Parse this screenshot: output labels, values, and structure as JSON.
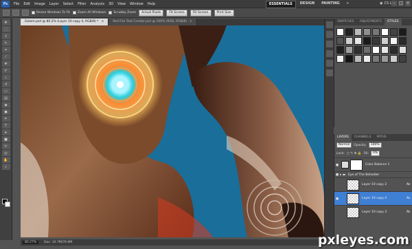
{
  "app": {
    "logo": "Ps",
    "menu": [
      "File",
      "Edit",
      "Image",
      "Layer",
      "Select",
      "Filter",
      "Analysis",
      "3D",
      "View",
      "Window",
      "Help"
    ],
    "workspaces": [
      "ESSENTIALS",
      "DESIGN",
      "PAINTING"
    ],
    "workspace_more": "»",
    "cs_live": "CS Live",
    "window_controls": [
      "–",
      "□",
      "×"
    ]
  },
  "options": {
    "resize_windows": "Resize Windows To Fit",
    "zoom_all": "Zoom All Windows",
    "scrubby_zoom": "Scrubby Zoom",
    "actual_pixels": "Actual Pixels",
    "fit_screen": "Fit Screen",
    "fill_screen": "Fill Screen",
    "print_size": "Print Size"
  },
  "documents": [
    {
      "title": "Golem.psd @ 80.2% (Layer 10 copy 4, RGB/8) *",
      "active": true
    },
    {
      "title": "Red Fire Text Creator.psd @ 100% (RGB, RGB/8)",
      "active": false
    }
  ],
  "status": {
    "zoom": "80.27%",
    "doc": "Doc: 10.7M/76.9M"
  },
  "styles_panel": {
    "tabs": [
      "SWATCHES",
      "ADJUSTMENTS",
      "STYLES"
    ],
    "swatch_colors": [
      "#ffffff",
      "#222222",
      "#bdbdbd",
      "#8f8f8f",
      "#777777",
      "#ffffff",
      "#444444",
      "#1c1c1c",
      "#555555",
      "#cfcfcf",
      "#e6e6e6",
      "#1a1a1a",
      "#3a3a3a",
      "#cfcfcf",
      "#f4f4f4",
      "#2a2a2a",
      "#202020",
      "#a0a0a0",
      "#303030",
      "#6d6d6d",
      "#ffffff",
      "#e6e6e6",
      "#2c2c2c",
      "#e0e0e0",
      "#f0f0f0",
      "#151515",
      "#bcbcbc",
      "#ececec",
      "#7a7a7a",
      "#999999",
      "#cfcfcf",
      "#404040"
    ]
  },
  "layers_panel": {
    "tabs": [
      "LAYERS",
      "CHANNELS",
      "PATHS"
    ],
    "blend_mode": "Normal",
    "opacity_label": "Opacity:",
    "opacity_value": "100%",
    "lock_label": "Lock:",
    "fill_label": "Fill:",
    "fill_value": "0%",
    "layers": [
      {
        "name": "Color Balance 1",
        "type": "adjustment",
        "selected": false
      },
      {
        "name": "Eye of The Beholder",
        "type": "group",
        "selected": false
      },
      {
        "name": "Layer 10 copy 2",
        "type": "pixel",
        "selected": false,
        "fx": "fx"
      },
      {
        "name": "Layer 10 copy 4",
        "type": "pixel",
        "selected": true,
        "fx": "fx"
      },
      {
        "name": "Layer 10 copy 3",
        "type": "pixel",
        "selected": false,
        "fx": "fx"
      }
    ]
  },
  "watermark": "pxleyes.com",
  "colors": {
    "canvas_sky": "#1a6e9a",
    "selection": "#3f7fd4",
    "accent_glow": "#ffb347"
  }
}
